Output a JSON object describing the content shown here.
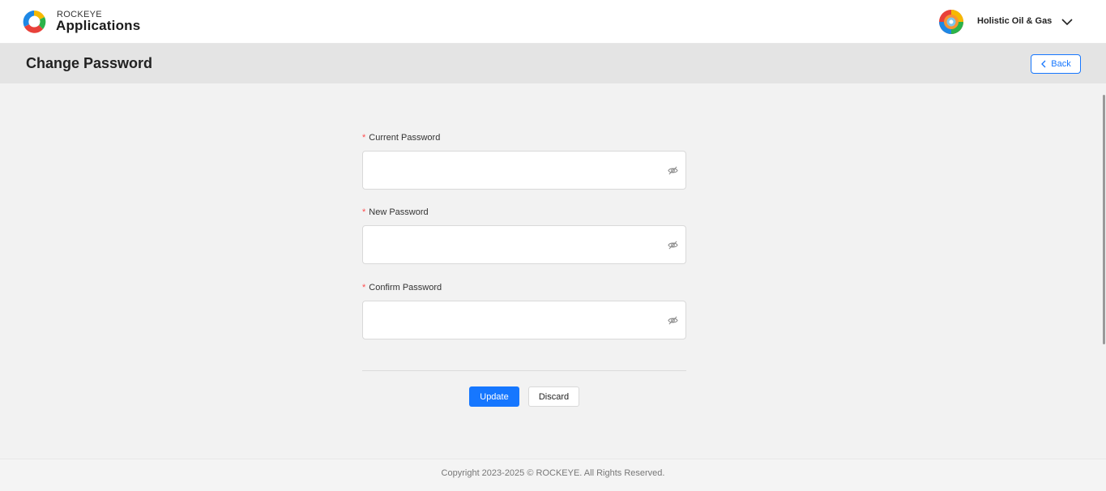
{
  "header": {
    "brand_small": "ROCKEYE",
    "brand_large": "Applications",
    "logo_icon": "rockeye-logo-icon",
    "company_name": "Holistic Oil & Gas",
    "company_logo_icon": "company-logo-icon",
    "company_menu_icon": "chevron-down-icon"
  },
  "page": {
    "title": "Change Password",
    "back_label": "Back",
    "back_icon": "chevron-left-icon"
  },
  "form": {
    "required_marker": "*",
    "fields": [
      {
        "label": "Current Password",
        "value": "",
        "icon": "eye-off-icon"
      },
      {
        "label": "New Password",
        "value": "",
        "icon": "eye-off-icon"
      },
      {
        "label": "Confirm Password",
        "value": "",
        "icon": "eye-off-icon"
      }
    ],
    "update_label": "Update",
    "discard_label": "Discard"
  },
  "footer": {
    "copyright": "Copyright 2023-2025 © ROCKEYE. All Rights Reserved."
  },
  "colors": {
    "primary": "#1677ff",
    "required": "#ff4d4f",
    "background": "#f2f2f2",
    "titlebar": "#e4e4e4"
  }
}
